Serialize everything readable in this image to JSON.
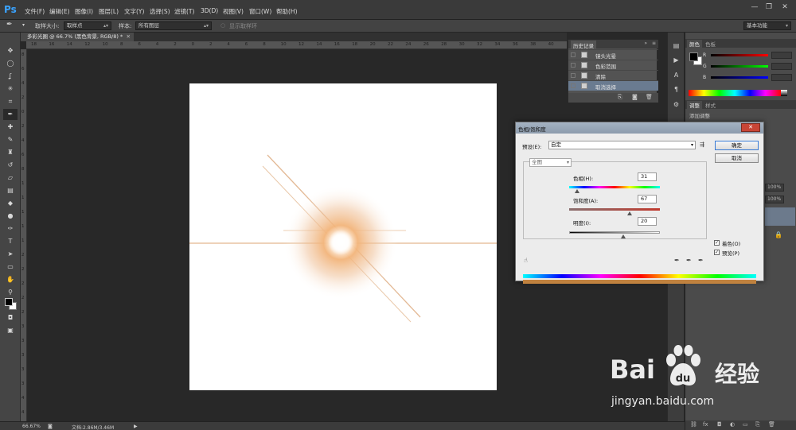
{
  "app": {
    "logo": "Ps",
    "menu": [
      "文件(F)",
      "编辑(E)",
      "图像(I)",
      "图层(L)",
      "文字(Y)",
      "选择(S)",
      "滤镜(T)",
      "3D(D)",
      "视图(V)",
      "窗口(W)",
      "帮助(H)"
    ],
    "window_controls": [
      "—",
      "❐",
      "✕"
    ]
  },
  "options_bar": {
    "sample_size_label": "取样大小:",
    "sample_size_value": "取样点",
    "sample_label": "样本:",
    "sample_value": "所有图层",
    "show_ring_label": "显示取样环",
    "workspace": "基本功能"
  },
  "document": {
    "tab_title": "多彩光圈 @ 66.7% (黑色背景, RGB/8) *",
    "h_ruler_ticks": [
      "18",
      "16",
      "14",
      "12",
      "10",
      "8",
      "6",
      "4",
      "2",
      "0",
      "2",
      "4",
      "6",
      "8",
      "10",
      "12",
      "14",
      "16",
      "18",
      "20",
      "22",
      "24",
      "26",
      "28",
      "30",
      "32",
      "34",
      "36",
      "38",
      "40"
    ],
    "v_ruler_ticks": [
      "8",
      "6",
      "4",
      "2",
      "0",
      "2",
      "4",
      "6",
      "8",
      "1",
      "1",
      "1",
      "1",
      "1",
      "2",
      "2",
      "2",
      "2",
      "2",
      "3",
      "3",
      "3",
      "3",
      "3",
      "4",
      "4"
    ]
  },
  "status": {
    "zoom": "66.67%",
    "doc_size": "文档:2.86M/3.46M"
  },
  "history": {
    "title": "历史记录",
    "items": [
      {
        "label": "镜头光晕",
        "selected": false
      },
      {
        "label": "色彩范围",
        "selected": false
      },
      {
        "label": "清除",
        "selected": false
      },
      {
        "label": "取消选择",
        "selected": true
      }
    ]
  },
  "right_panels": {
    "color_tabs": [
      "颜色",
      "色板"
    ],
    "color_rows": [
      "R",
      "G",
      "B"
    ],
    "adjust_tabs": [
      "调整",
      "样式"
    ],
    "adjust_hint": "添加调整",
    "layer_opacity": "100%",
    "layer_fill": "100%"
  },
  "dialog": {
    "title": "色相/饱和度",
    "preset_label": "预设(E):",
    "preset_value": "自定",
    "ok": "确定",
    "cancel": "取消",
    "channel": "全图",
    "hue_label": "色相(H):",
    "hue_value": "31",
    "saturation_label": "饱和度(A):",
    "saturation_value": "67",
    "lightness_label": "明度(I):",
    "lightness_value": "20",
    "colorize_label": "着色(O)",
    "preview_label": "预览(P)",
    "colorize_checked": true,
    "preview_checked": true,
    "hue_level": 0.086,
    "saturation_level": 0.67,
    "lightness_level": 0.6
  },
  "watermark": {
    "bai": "Bai",
    "du": "经验",
    "url": "jingyan.baidu.com"
  }
}
